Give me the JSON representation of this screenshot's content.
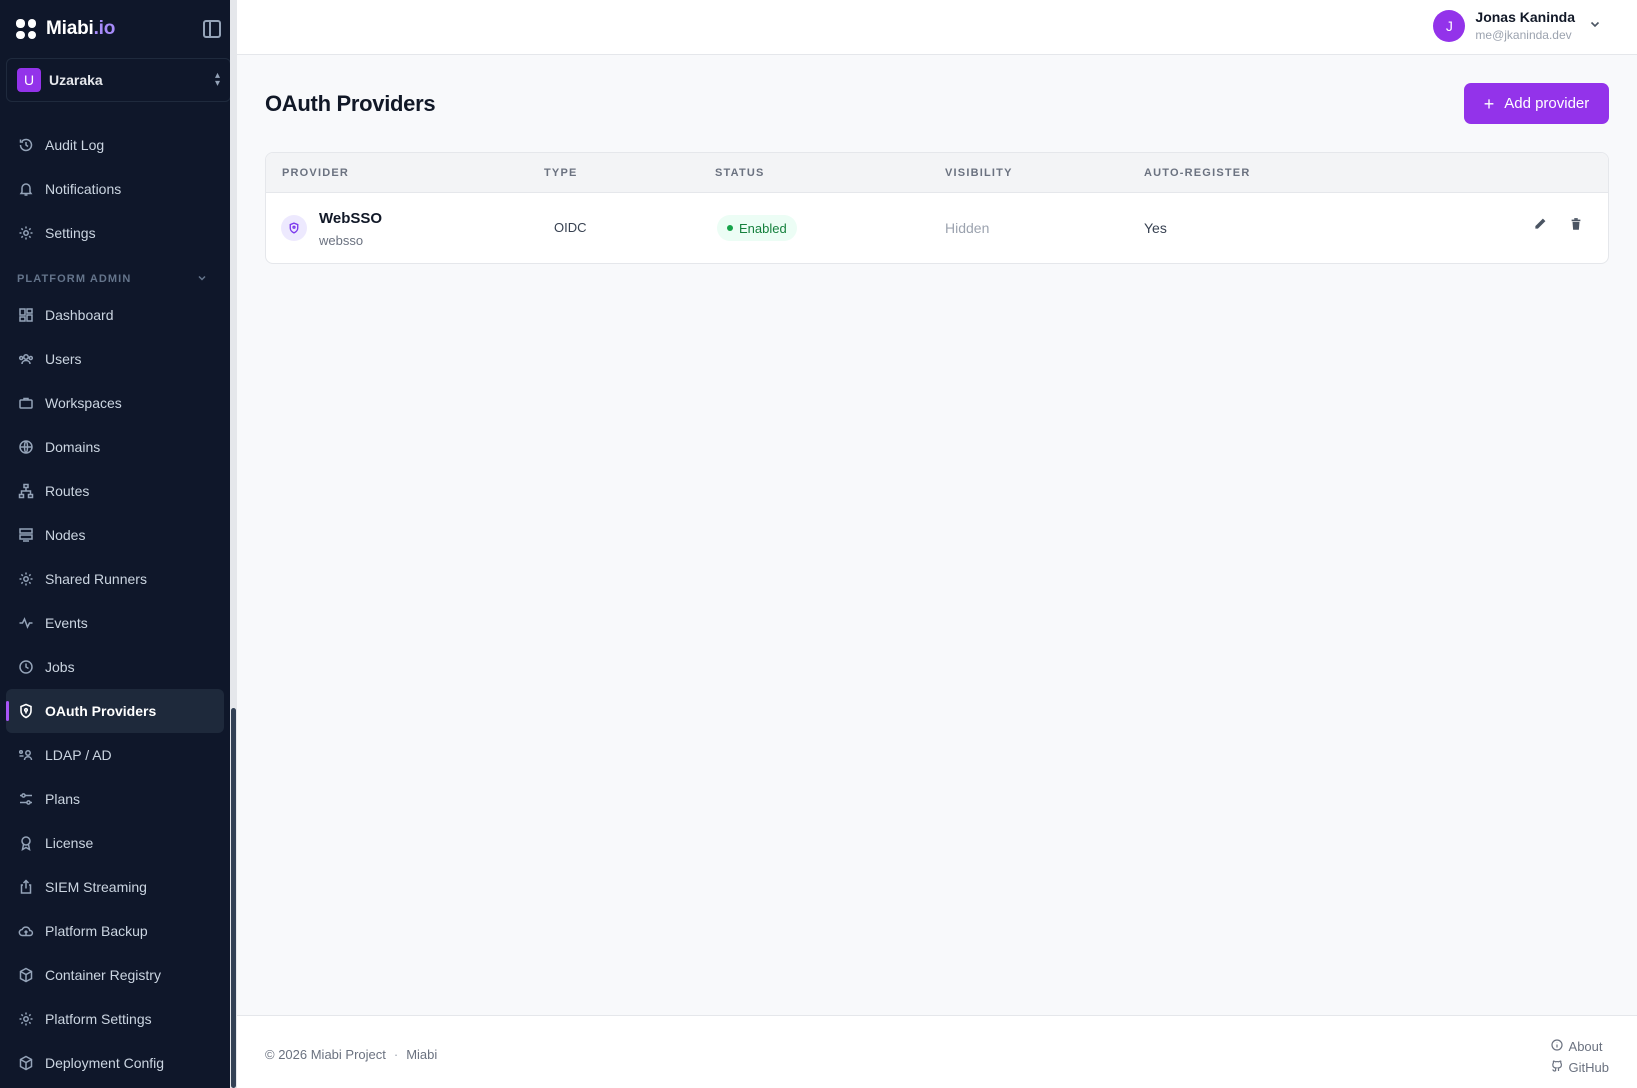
{
  "brand": {
    "name_main": "Miabi",
    "name_accent": ".io"
  },
  "workspace": {
    "initial": "U",
    "name": "Uzaraka"
  },
  "nav_top": [
    {
      "label": "Audit Log",
      "icon": "history-icon"
    },
    {
      "label": "Notifications",
      "icon": "bell-icon"
    },
    {
      "label": "Settings",
      "icon": "gear-icon"
    }
  ],
  "section": {
    "label": "PLATFORM ADMIN"
  },
  "nav_admin": [
    {
      "label": "Dashboard",
      "icon": "dashboard-icon"
    },
    {
      "label": "Users",
      "icon": "users-icon"
    },
    {
      "label": "Workspaces",
      "icon": "briefcase-icon"
    },
    {
      "label": "Domains",
      "icon": "globe-icon"
    },
    {
      "label": "Routes",
      "icon": "sitemap-icon"
    },
    {
      "label": "Nodes",
      "icon": "server-icon"
    },
    {
      "label": "Shared Runners",
      "icon": "gear-icon"
    },
    {
      "label": "Events",
      "icon": "activity-icon"
    },
    {
      "label": "Jobs",
      "icon": "clock-icon"
    },
    {
      "label": "OAuth Providers",
      "icon": "shield-icon",
      "active": true
    },
    {
      "label": "LDAP / AD",
      "icon": "ldap-icon"
    },
    {
      "label": "Plans",
      "icon": "sliders-icon"
    },
    {
      "label": "License",
      "icon": "award-icon"
    },
    {
      "label": "SIEM Streaming",
      "icon": "export-icon"
    },
    {
      "label": "Platform Backup",
      "icon": "cloud-icon"
    },
    {
      "label": "Container Registry",
      "icon": "box-icon"
    },
    {
      "label": "Platform Settings",
      "icon": "gear-icon"
    },
    {
      "label": "Deployment Config",
      "icon": "box-icon"
    }
  ],
  "user": {
    "initial": "J",
    "name": "Jonas Kaninda",
    "email": "me@jkaninda.dev"
  },
  "page": {
    "title": "OAuth Providers",
    "add_label": "Add provider"
  },
  "table": {
    "headers": {
      "provider": "PROVIDER",
      "type": "TYPE",
      "status": "STATUS",
      "visibility": "VISIBILITY",
      "auto_register": "AUTO-REGISTER"
    },
    "rows": [
      {
        "name": "WebSSO",
        "slug": "websso",
        "type": "OIDC",
        "status": "Enabled",
        "visibility": "Hidden",
        "auto_register": "Yes"
      }
    ]
  },
  "footer": {
    "copyright": "© 2026 Miabi Project",
    "separator": "·",
    "project": "Miabi",
    "about": "About",
    "github": "GitHub"
  },
  "colors": {
    "accent": "#9333ea",
    "sidebar_bg": "#0f172a",
    "status_green": "#16a34a"
  }
}
